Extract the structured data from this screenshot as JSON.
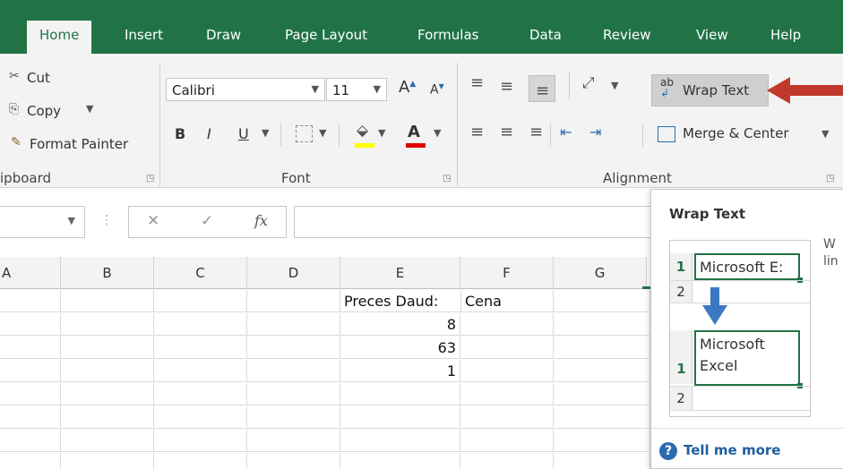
{
  "tabs": {
    "home": "Home",
    "insert": "Insert",
    "draw": "Draw",
    "page_layout": "Page Layout",
    "formulas": "Formulas",
    "data": "Data",
    "review": "Review",
    "view": "View",
    "help": "Help"
  },
  "clipboard": {
    "cut": "Cut",
    "copy": "Copy",
    "format_painter": "Format Painter",
    "group_label": "ipboard"
  },
  "font": {
    "font_name": "Calibri",
    "font_size": "11",
    "bold": "B",
    "italic": "I",
    "underline": "U",
    "group_label": "Font"
  },
  "alignment": {
    "wrap_text": "Wrap Text",
    "wrap_icon_text": "ab",
    "merge_center": "Merge & Center",
    "group_label": "Alignment"
  },
  "formula_bar": {
    "fx": "fx",
    "value": ""
  },
  "grid": {
    "columns": [
      "A",
      "B",
      "C",
      "D",
      "E",
      "F",
      "G"
    ],
    "rows": [
      {
        "E": "Preces Daud:",
        "F": "Cena"
      },
      {
        "E": "8",
        "F": ""
      },
      {
        "E": "63",
        "F": ""
      },
      {
        "E": "1",
        "F": ""
      },
      {
        "E": "",
        "F": ""
      },
      {
        "E": "",
        "F": ""
      },
      {
        "E": "",
        "F": ""
      },
      {
        "E": "",
        "F": ""
      }
    ]
  },
  "tooltip": {
    "title": "Wrap Text",
    "description": "W lin",
    "demo_before": "Microsoft E:",
    "demo_after_line1": "Microsoft",
    "demo_after_line2": "Excel",
    "row1": "1",
    "row2": "2",
    "tell_me_more": "Tell me more",
    "help_glyph": "?"
  },
  "colors": {
    "excel_green": "#217346",
    "annotation_arrow": "#c0392b",
    "demo_arrow": "#3a78c2"
  }
}
